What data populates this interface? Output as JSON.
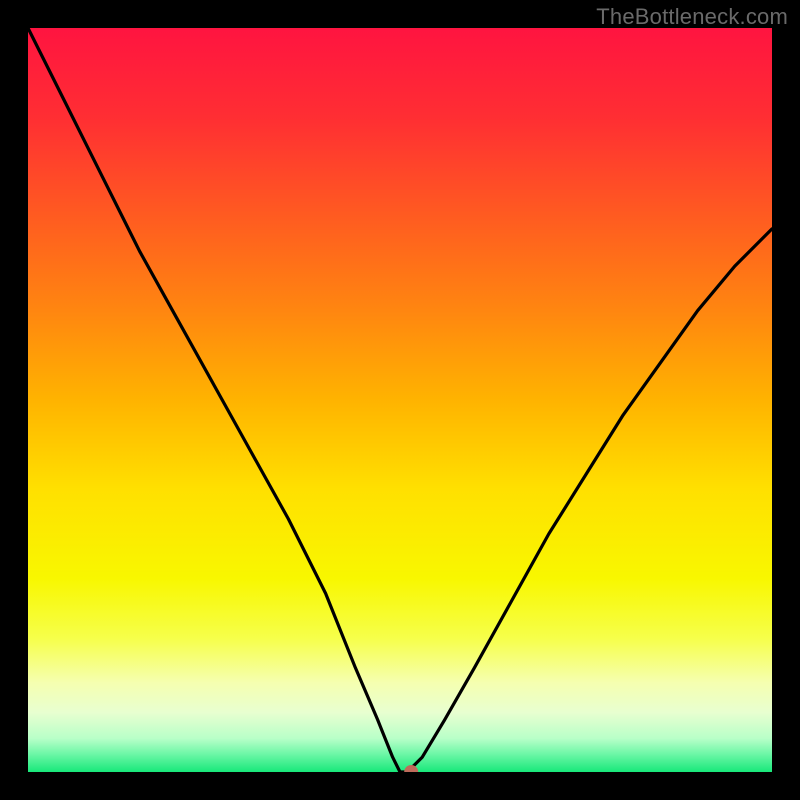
{
  "watermark": "TheBottleneck.com",
  "gradient": {
    "stops": [
      {
        "offset": 0.0,
        "color": "#ff1440"
      },
      {
        "offset": 0.12,
        "color": "#ff2e33"
      },
      {
        "offset": 0.25,
        "color": "#ff5a21"
      },
      {
        "offset": 0.38,
        "color": "#ff8610"
      },
      {
        "offset": 0.5,
        "color": "#ffb300"
      },
      {
        "offset": 0.62,
        "color": "#ffe000"
      },
      {
        "offset": 0.74,
        "color": "#f8f700"
      },
      {
        "offset": 0.82,
        "color": "#f6ff4a"
      },
      {
        "offset": 0.88,
        "color": "#f5ffb0"
      },
      {
        "offset": 0.92,
        "color": "#e8ffd0"
      },
      {
        "offset": 0.955,
        "color": "#b8ffc8"
      },
      {
        "offset": 0.975,
        "color": "#70f7a8"
      },
      {
        "offset": 1.0,
        "color": "#18e87a"
      }
    ]
  },
  "chart_data": {
    "type": "line",
    "title": "",
    "xlabel": "",
    "ylabel": "",
    "xlim": [
      0,
      100
    ],
    "ylim": [
      0,
      100
    ],
    "grid": false,
    "legend": "none",
    "series": [
      {
        "name": "bottleneck-curve",
        "x": [
          0,
          5,
          10,
          15,
          20,
          25,
          30,
          35,
          40,
          44,
          47,
          49,
          50,
          51,
          53,
          56,
          60,
          65,
          70,
          75,
          80,
          85,
          90,
          95,
          100
        ],
        "y": [
          100,
          90,
          80,
          70,
          61,
          52,
          43,
          34,
          24,
          14,
          7,
          2,
          0,
          0,
          2,
          7,
          14,
          23,
          32,
          40,
          48,
          55,
          62,
          68,
          73
        ]
      }
    ],
    "marker": {
      "x": 51.5,
      "y": 0,
      "color": "#bf6b5b"
    },
    "background": "red-yellow-green vertical gradient"
  }
}
